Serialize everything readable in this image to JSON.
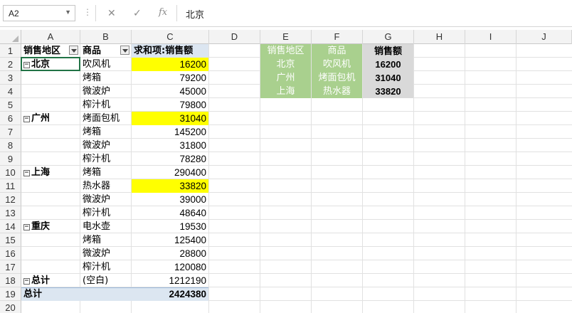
{
  "name_box": "A2",
  "formula_value": "北京",
  "formula_buttons": {
    "cancel": "✕",
    "enter": "✓",
    "fx": "fx"
  },
  "columns": [
    "A",
    "B",
    "C",
    "D",
    "E",
    "F",
    "G",
    "H",
    "I",
    "J"
  ],
  "rows": [
    "1",
    "2",
    "3",
    "4",
    "5",
    "6",
    "7",
    "8",
    "9",
    "10",
    "11",
    "12",
    "13",
    "14",
    "15",
    "16",
    "17",
    "18",
    "19",
    "20"
  ],
  "pivot": {
    "header_region": "销售地区",
    "header_product": "商品",
    "header_value": "求和项:销售额",
    "rows": [
      {
        "region": "北京",
        "product": "吹风机",
        "value": "16200",
        "highlight": true
      },
      {
        "region": "",
        "product": "烤箱",
        "value": "79200"
      },
      {
        "region": "",
        "product": "微波炉",
        "value": "45000"
      },
      {
        "region": "",
        "product": "榨汁机",
        "value": "79800"
      },
      {
        "region": "广州",
        "product": "烤面包机",
        "value": "31040",
        "highlight": true
      },
      {
        "region": "",
        "product": "烤箱",
        "value": "145200"
      },
      {
        "region": "",
        "product": "微波炉",
        "value": "31800"
      },
      {
        "region": "",
        "product": "榨汁机",
        "value": "78280"
      },
      {
        "region": "上海",
        "product": "烤箱",
        "value": "290400"
      },
      {
        "region": "",
        "product": "热水器",
        "value": "33820",
        "highlight": true
      },
      {
        "region": "",
        "product": "微波炉",
        "value": "39000"
      },
      {
        "region": "",
        "product": "榨汁机",
        "value": "48640"
      },
      {
        "region": "重庆",
        "product": "电水壶",
        "value": "19530"
      },
      {
        "region": "",
        "product": "烤箱",
        "value": "125400"
      },
      {
        "region": "",
        "product": "微波炉",
        "value": "28800"
      },
      {
        "region": "",
        "product": "榨汁机",
        "value": "120080"
      },
      {
        "region": "总计",
        "product": "(空白)",
        "value": "1212190"
      }
    ],
    "grand_total_label": "总计",
    "grand_total_value": "2424380"
  },
  "summary_table": {
    "headers": [
      "销售地区",
      "商品",
      "销售额"
    ],
    "rows": [
      [
        "北京",
        "吹风机",
        "16200"
      ],
      [
        "广州",
        "烤面包机",
        "31040"
      ],
      [
        "上海",
        "热水器",
        "33820"
      ]
    ]
  },
  "colors": {
    "highlight": "#ffff00",
    "header_green": "#a9d08e",
    "total_blue": "#dce6f1",
    "value_grey": "#d9d9d9"
  }
}
